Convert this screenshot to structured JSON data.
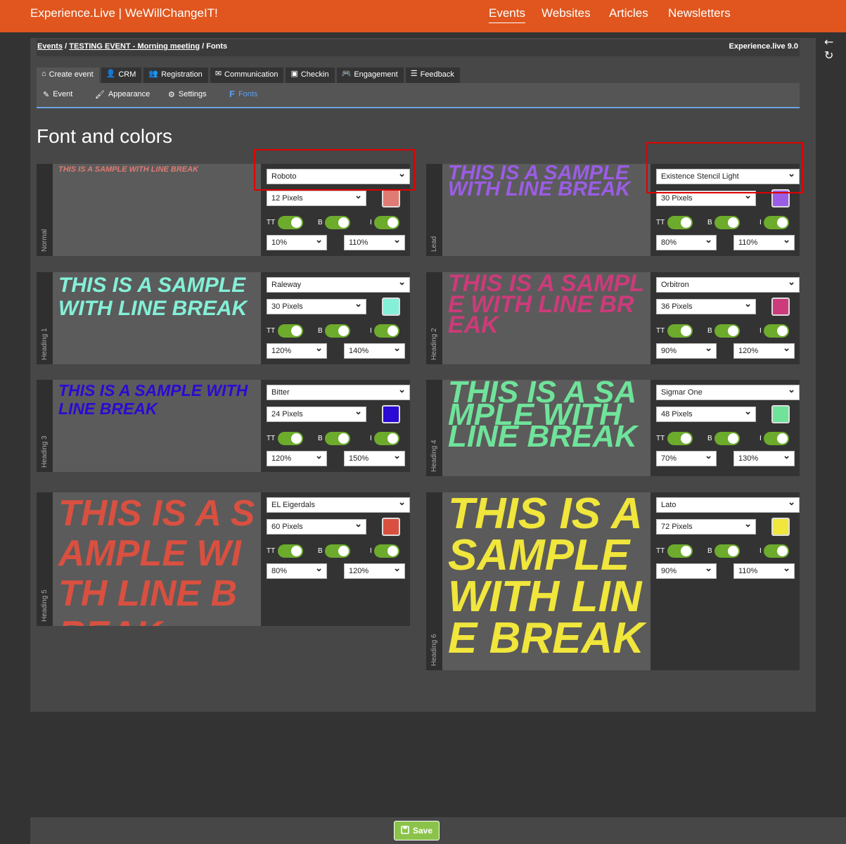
{
  "header": {
    "brand": "Experience.Live | WeWillChangeIT!",
    "nav": [
      "Events",
      "Websites",
      "Articles",
      "Newsletters"
    ],
    "active_nav": "Events"
  },
  "side_icons": {
    "back": "←",
    "refresh": "↻"
  },
  "breadcrumb": {
    "events": "Events",
    "sep": "/",
    "event": "TESTING EVENT - Morning meeting",
    "current": "Fonts",
    "version": "Experience.live 9.0"
  },
  "tabs": [
    {
      "label": "Create event",
      "icon": "home-icon",
      "glyph": "⌂"
    },
    {
      "label": "CRM",
      "icon": "user-icon",
      "glyph": "👤"
    },
    {
      "label": "Registration",
      "icon": "users-icon",
      "glyph": "👥"
    },
    {
      "label": "Communication",
      "icon": "envelope-icon",
      "glyph": "✉"
    },
    {
      "label": "Checkin",
      "icon": "id-card-icon",
      "glyph": "▣"
    },
    {
      "label": "Engagement",
      "icon": "gamepad-icon",
      "glyph": "🎮"
    },
    {
      "label": "Feedback",
      "icon": "comments-icon",
      "glyph": "☰"
    }
  ],
  "subnav": [
    {
      "label": "Event",
      "icon": "pencil-icon",
      "glyph": "✎"
    },
    {
      "label": "Appearance",
      "icon": "paint-brush-icon",
      "glyph": "🖌"
    },
    {
      "label": "Settings",
      "icon": "gear-icon",
      "glyph": "⚙"
    },
    {
      "label": "Fonts",
      "icon": "font-icon",
      "glyph": "F"
    }
  ],
  "page_title": "Font and colors",
  "toggle_labels": {
    "tt": "TT",
    "b": "B",
    "i": "I"
  },
  "cards": [
    {
      "label": "Normal",
      "sample": "THIS IS A SAMPLE WITH LINE BREAK",
      "font": "Roboto",
      "size": "12 Pixels",
      "color": "#e07b73",
      "left": "10%",
      "right": "110%"
    },
    {
      "label": "Lead",
      "sample": "THIS IS A SAMPLE WITH LINE BREAK",
      "font": "Existence Stencil Light",
      "size": "30 Pixels",
      "color": "#9b5de5",
      "left": "80%",
      "right": "110%"
    },
    {
      "label": "Heading 1",
      "sample": "THIS IS A SAMPLE WITH LINE BREAK",
      "font": "Raleway",
      "size": "30 Pixels",
      "color": "#84f0d8",
      "left": "120%",
      "right": "140%"
    },
    {
      "label": "Heading 2",
      "sample": "THIS IS A SAMPLE WITH LINE BREAK",
      "font": "Orbitron",
      "size": "36 Pixels",
      "color": "#cc3b7a",
      "left": "90%",
      "right": "120%"
    },
    {
      "label": "Heading 3",
      "sample": "THIS IS A SAMPLE WITH LINE BREAK",
      "font": "Bitter",
      "size": "24 Pixels",
      "color": "#2a0ad4",
      "left": "120%",
      "right": "150%"
    },
    {
      "label": "Heading 4",
      "sample": "THIS IS A SAMPLE WITH LINE BREAK",
      "font": "Sigmar One",
      "size": "48 Pixels",
      "color": "#6fe39a",
      "left": "70%",
      "right": "130%"
    },
    {
      "label": "Heading 5",
      "sample": "THIS IS A SAMPLE WITH LINE BREAK",
      "font": "EL Eigerdals",
      "size": "60 Pixels",
      "color": "#d95040",
      "left": "80%",
      "right": "120%"
    },
    {
      "label": "Heading 6",
      "sample": "THIS IS A SAMPLE WITH LINE BREAK",
      "font": "Lato",
      "size": "72 Pixels",
      "color": "#f0e63c",
      "left": "90%",
      "right": "110%"
    }
  ],
  "footer": {
    "save_label": "Save",
    "save_icon": "save-icon"
  }
}
